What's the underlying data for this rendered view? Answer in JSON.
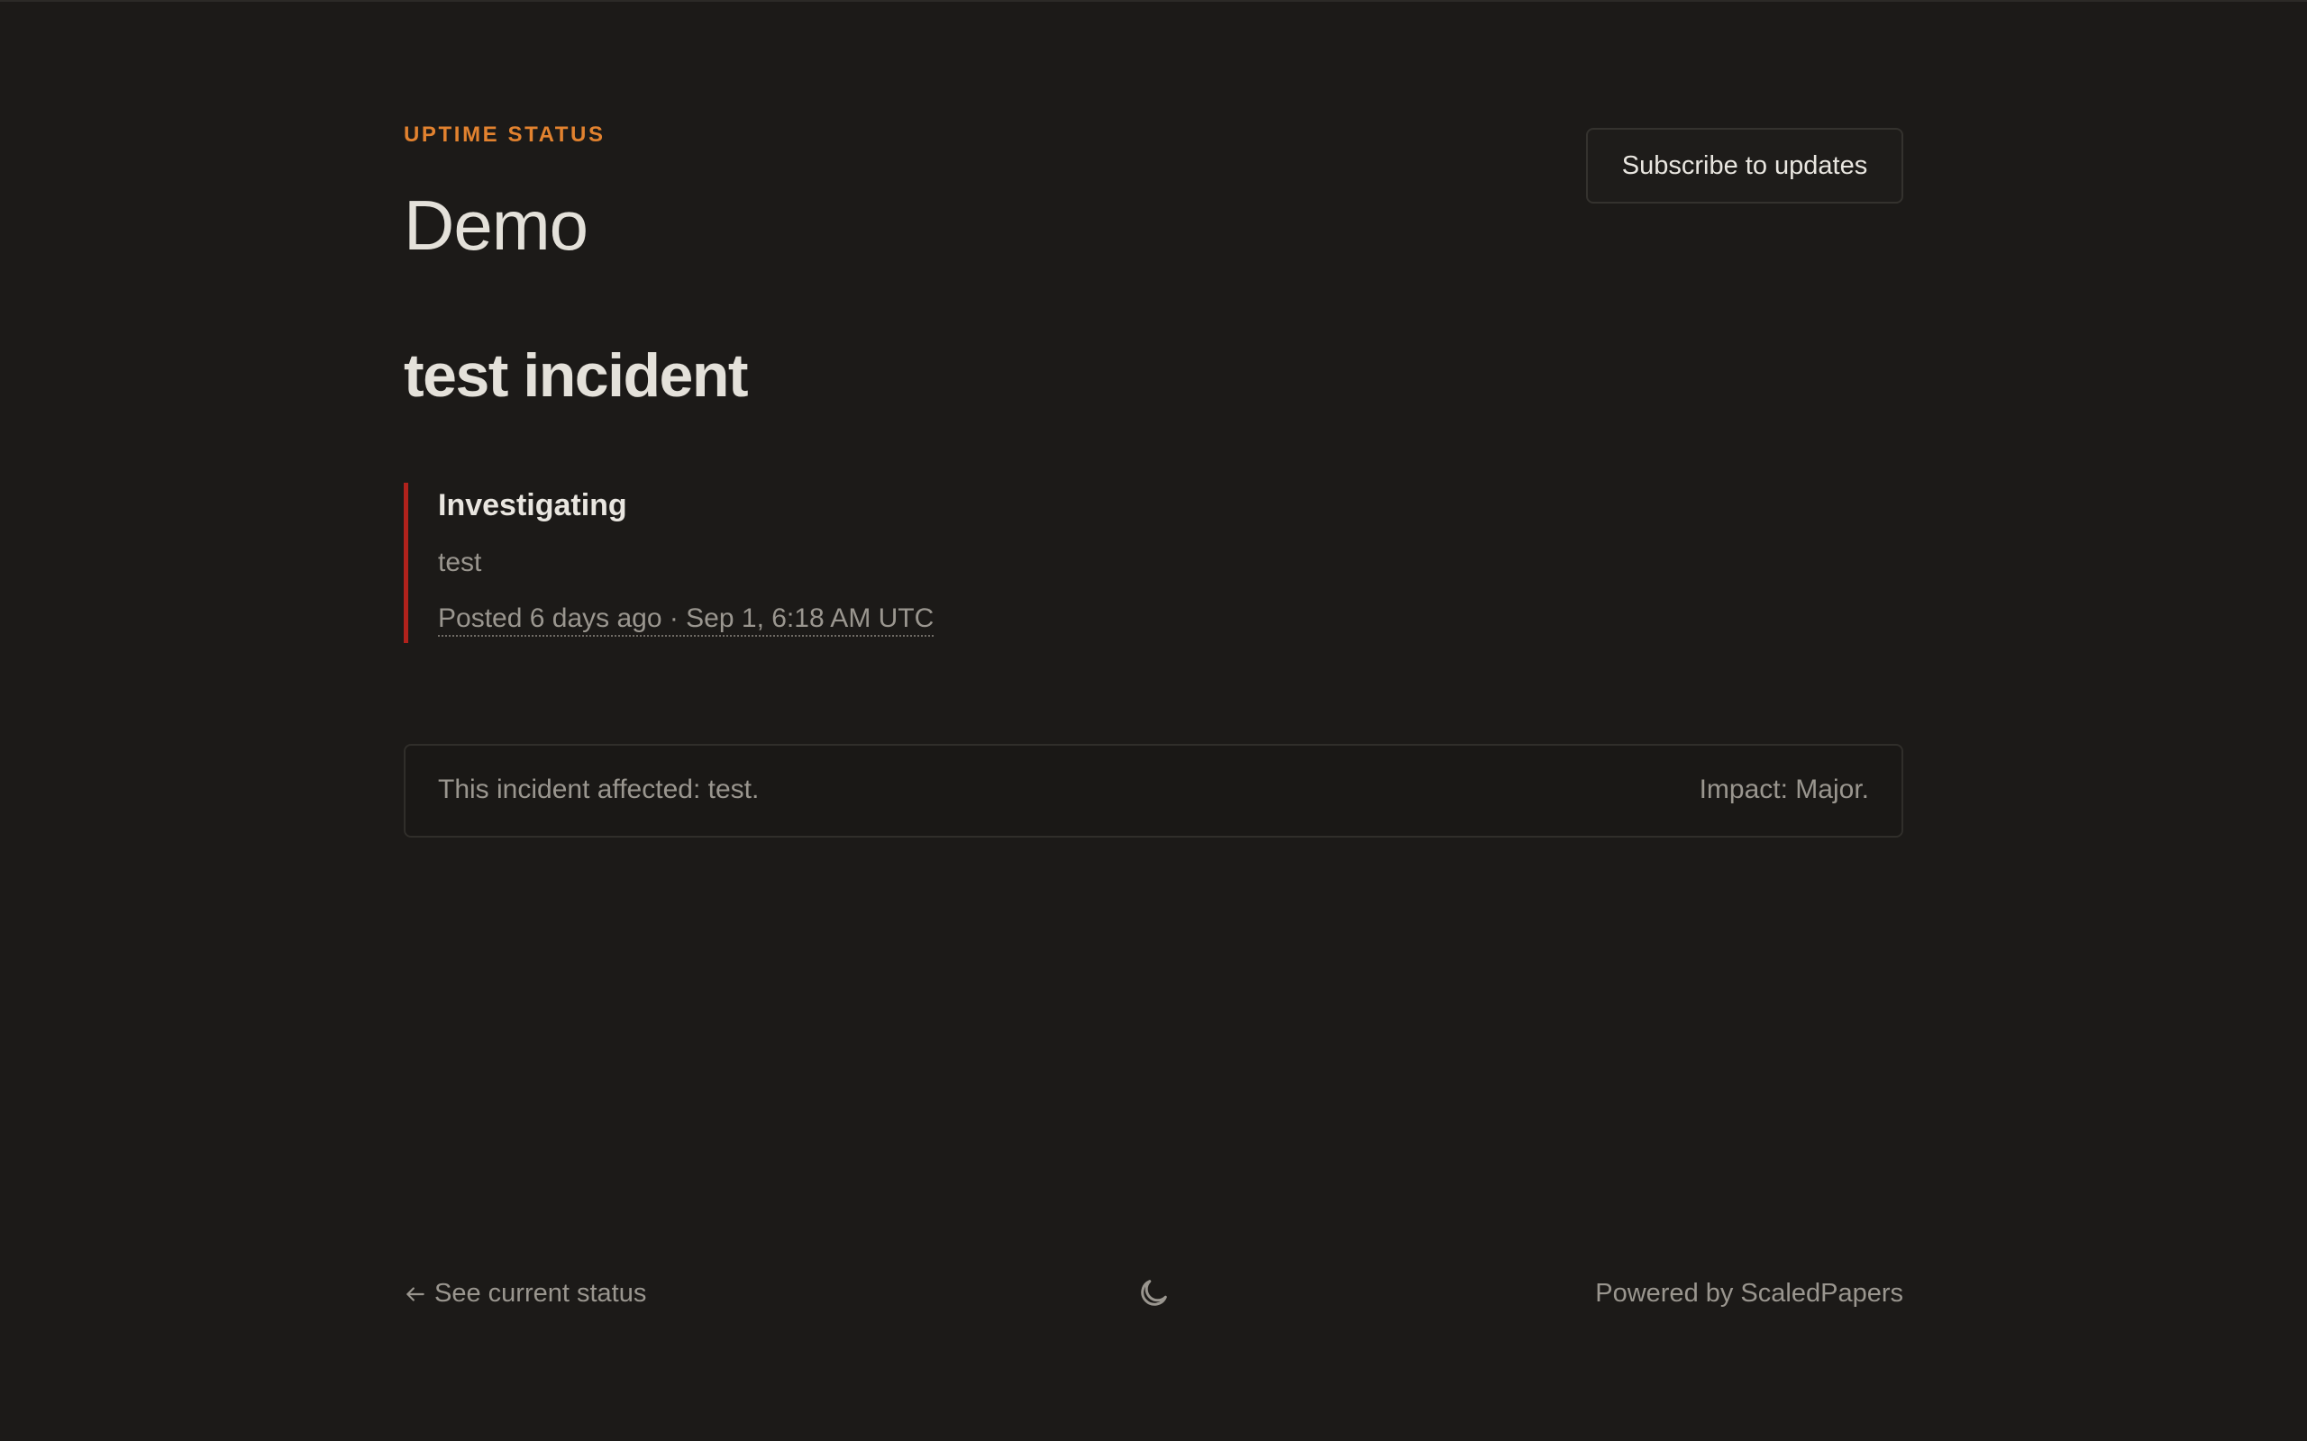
{
  "header": {
    "eyebrow": "UPTIME STATUS",
    "title": "Demo",
    "subscribe_label": "Subscribe to updates"
  },
  "incident": {
    "title": "test incident",
    "updates": [
      {
        "status": "Investigating",
        "body": "test",
        "posted": "Posted 6 days ago · Sep 1, 6:18 AM UTC",
        "status_color": "#b1221c"
      }
    ],
    "affected": "This incident affected: test.",
    "impact": "Impact: Major."
  },
  "footer": {
    "back_label": "See current status",
    "back_icon": "arrow-left-icon",
    "theme_icon": "moon-icon",
    "powered_by": "Powered by ScaledPapers"
  },
  "colors": {
    "accent": "#e2822f",
    "background": "#1c1a18",
    "major": "#b1221c"
  }
}
